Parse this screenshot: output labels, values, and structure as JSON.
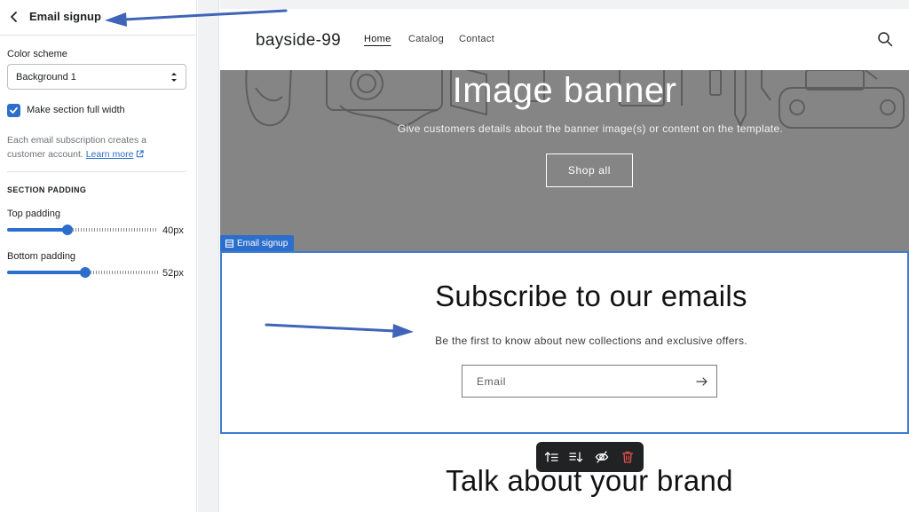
{
  "panel": {
    "title": "Email signup",
    "color_scheme_label": "Color scheme",
    "color_scheme_value": "Background 1",
    "full_width_label": "Make section full width",
    "full_width_checked": true,
    "help_text": "Each email subscription creates a customer account.",
    "help_link": "Learn more",
    "section_padding_heading": "SECTION PADDING",
    "top_padding": {
      "label": "Top padding",
      "value": "40px",
      "level": 0.4
    },
    "bottom_padding": {
      "label": "Bottom padding",
      "value": "52px",
      "level": 0.52
    }
  },
  "store": {
    "name": "bayside-99",
    "nav": [
      "Home",
      "Catalog",
      "Contact"
    ]
  },
  "banner": {
    "title": "Image banner",
    "subtitle": "Give customers details about the banner image(s) or content on the template.",
    "button": "Shop all"
  },
  "section_tag": "Email signup",
  "signup": {
    "title": "Subscribe to our emails",
    "subtitle": "Be the first to know about new collections and exclusive offers.",
    "email_placeholder": "Email"
  },
  "next_section_title": "Talk about your brand",
  "colors": {
    "accent": "#2c6ecb",
    "annotation_arrow": "#3f64b8",
    "banner_bg": "#858585",
    "toolbar_bg": "#202223",
    "delete": "#e0504a"
  },
  "icons": {
    "back": "chevron-left-icon",
    "select": "select-arrows-icon",
    "checkbox": "checkmark-icon",
    "external": "external-link-icon",
    "search": "search-icon",
    "submit": "arrow-right-icon",
    "section": "section-icon",
    "toolbar": [
      "move-up-icon",
      "move-down-icon",
      "hide-icon",
      "delete-icon"
    ]
  }
}
